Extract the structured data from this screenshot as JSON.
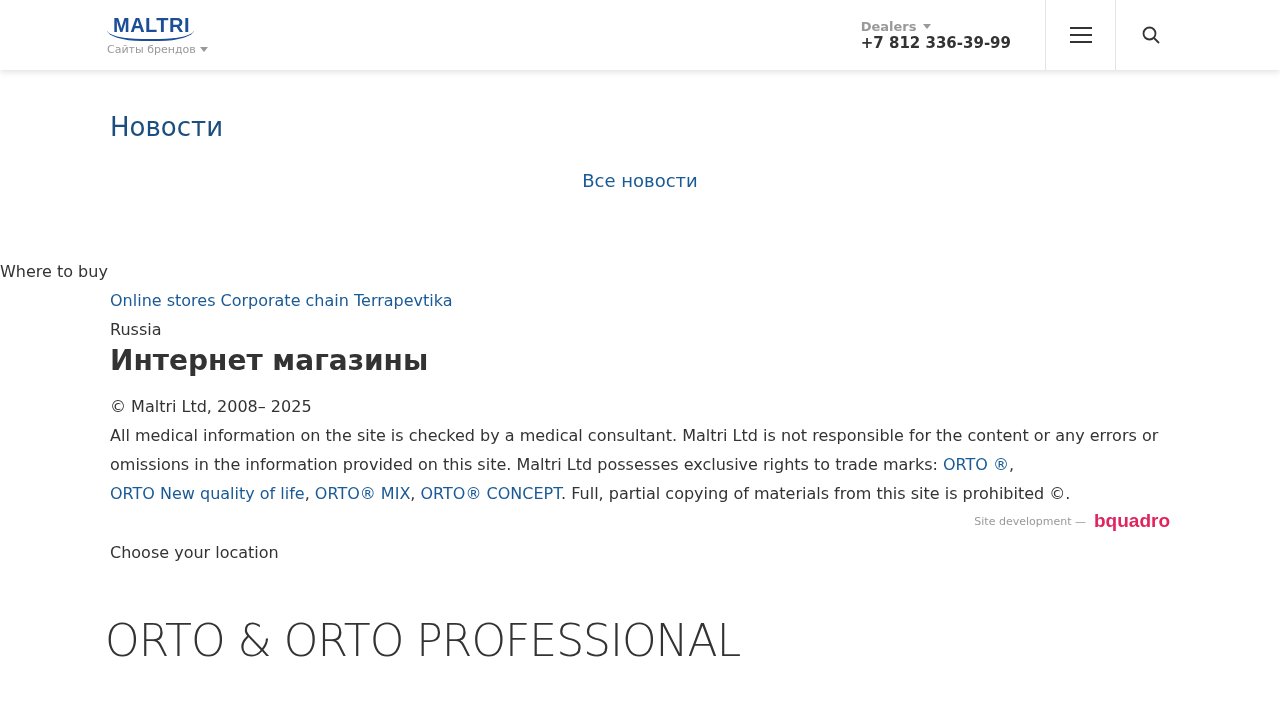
{
  "header": {
    "logo": "MALTRI",
    "brand_sites": "Сайты брендов",
    "dealers": "Dealers",
    "phone": "+7 812 336-39-99"
  },
  "news": {
    "title": "Новости",
    "all_link": "Все новости"
  },
  "where_to_buy": {
    "title": "Where to buy",
    "tabs": [
      {
        "label": "Online stores"
      },
      {
        "label": "Corporate chain Terrapevtika"
      }
    ],
    "country": "Russia",
    "heading": "Интернет магазины"
  },
  "footer": {
    "copyright": "© Maltri Ltd, 2008– 2025",
    "legal": [
      {
        "kind": "text",
        "text": "All medical information on the site is checked by a medical consultant. Maltri Ltd is not responsible for the content or any errors or omissions in the information provided on this site. Maltri Ltd possesses exclusive rights to trade marks: "
      },
      {
        "kind": "link",
        "text": "ORTO ®"
      },
      {
        "kind": "text",
        "text": ", "
      },
      {
        "kind": "link",
        "text": "ORTO New quality of life"
      },
      {
        "kind": "text",
        "text": ", "
      },
      {
        "kind": "link",
        "text": "ORTO® MIX"
      },
      {
        "kind": "text",
        "text": ", "
      },
      {
        "kind": "link",
        "text": "ORTO® CONCEPT"
      },
      {
        "kind": "text",
        "text": ". Full, partial copying of materials from this site is prohibited ©."
      }
    ],
    "dev_label": "Site development —",
    "dev_logo": "bquadro",
    "location": "Choose your location"
  },
  "brand_banner": "ORTO & ORTO PROFESSIONAL"
}
